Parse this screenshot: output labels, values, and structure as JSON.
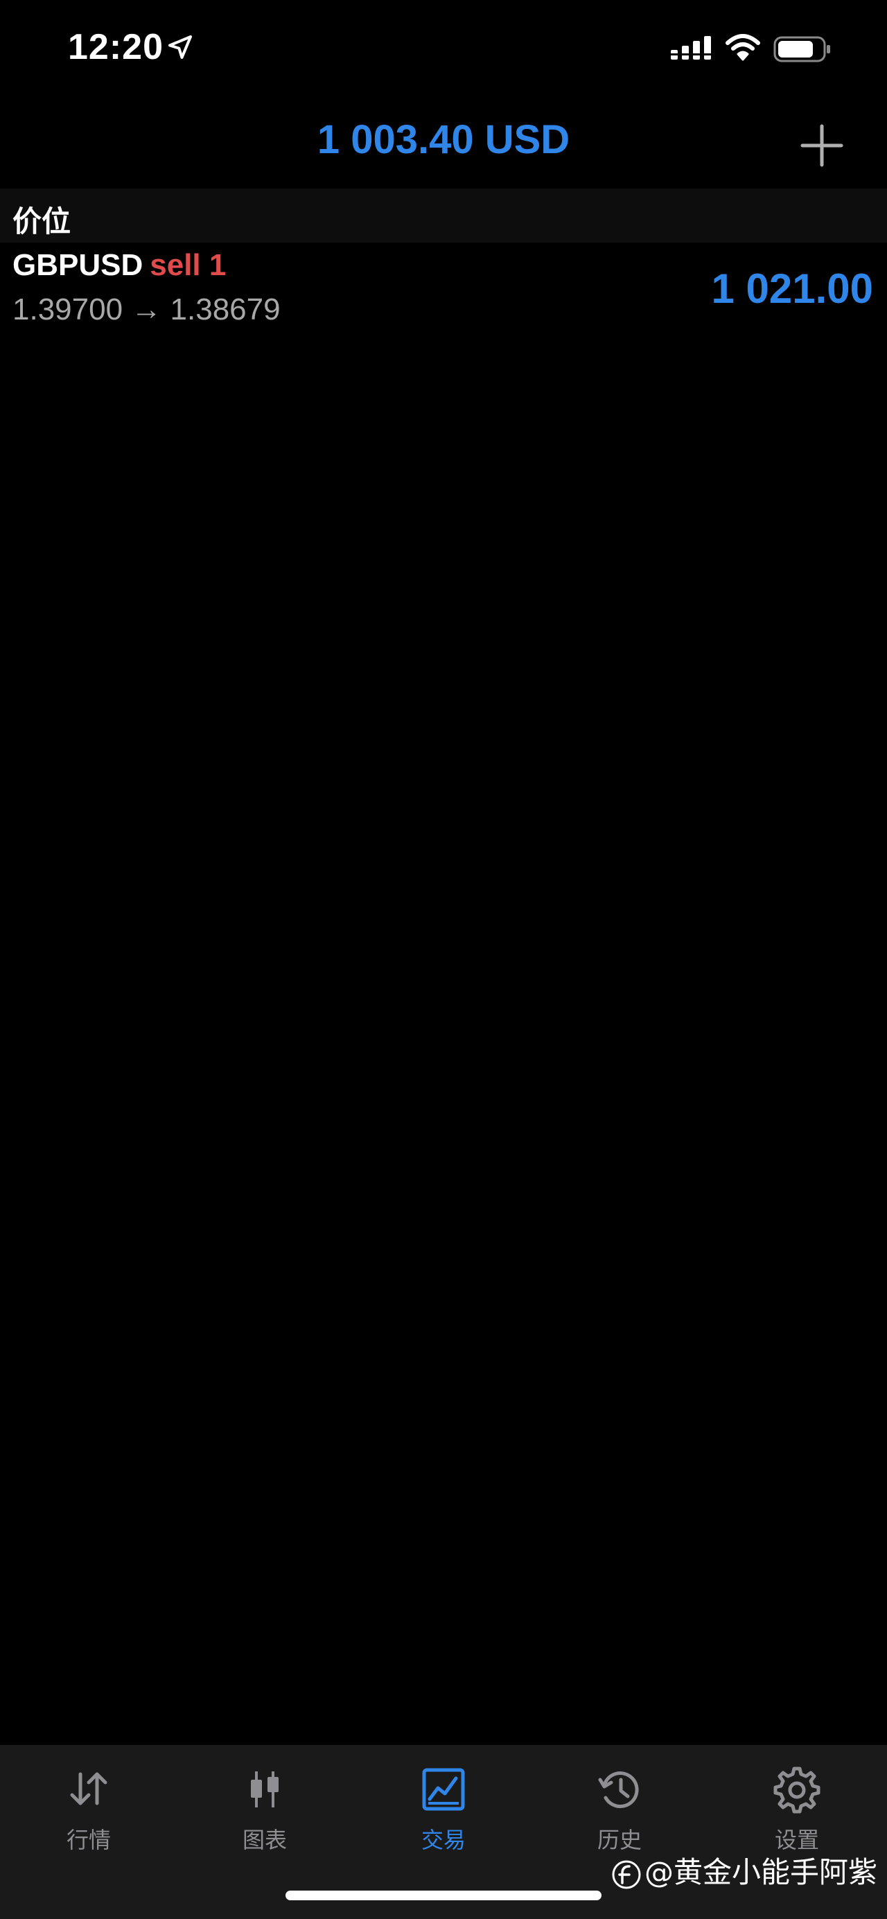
{
  "status_bar": {
    "time": "12:20"
  },
  "header": {
    "balance": "1 003.40 USD"
  },
  "section": {
    "title": "价位"
  },
  "position": {
    "symbol": "GBPUSD",
    "type": "sell 1",
    "open_price": "1.39700",
    "arrow": "→",
    "current_price": "1.38679",
    "profit": "1 021.00"
  },
  "tabs": [
    {
      "label": "行情",
      "icon": "arrows-up-down-icon",
      "active": false
    },
    {
      "label": "图表",
      "icon": "candlestick-icon",
      "active": false
    },
    {
      "label": "交易",
      "icon": "trade-chart-icon",
      "active": true
    },
    {
      "label": "历史",
      "icon": "history-icon",
      "active": false
    },
    {
      "label": "设置",
      "icon": "gear-icon",
      "active": false
    }
  ],
  "watermark": {
    "text": "@黄金小能手阿紫"
  },
  "colors": {
    "background": "#000000",
    "accent_blue": "#2f86e8",
    "sell_red": "#e04b4b",
    "secondary_text": "#a8a8a8",
    "tab_inactive": "#8e8e93",
    "tab_bar_bg": "#1a1a1a",
    "section_bg": "#0d0d0d"
  }
}
